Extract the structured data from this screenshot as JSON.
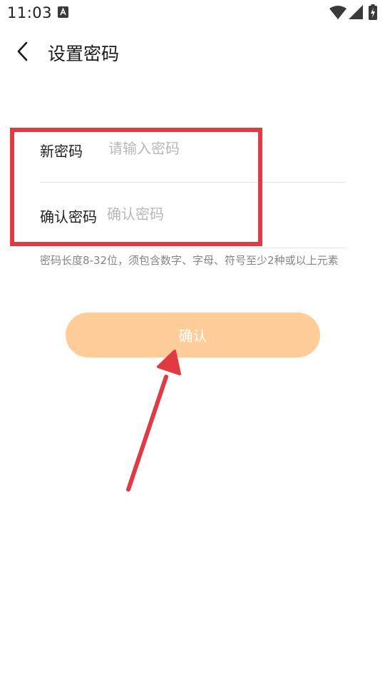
{
  "status_bar": {
    "time": "11:03",
    "icons": [
      "notification-a-icon",
      "wifi-icon",
      "signal-icon",
      "battery-charging-icon"
    ]
  },
  "header": {
    "back_icon": "chevron-left-icon",
    "title": "设置密码"
  },
  "form": {
    "new_password": {
      "label": "新密码",
      "placeholder": "请输入密码",
      "value": ""
    },
    "confirm_password": {
      "label": "确认密码",
      "placeholder": "确认密码",
      "value": ""
    },
    "hint": "密码长度8-32位，须包含数字、字母、符号至少2种或以上元素"
  },
  "confirm_button": {
    "label": "确认",
    "enabled": false
  },
  "annotation": {
    "color": "#e03a44"
  },
  "colors": {
    "button_bg": "#ffcd99",
    "button_text": "#ffffff",
    "placeholder": "#b8b8b8",
    "hint": "#858585",
    "divider": "#e3e3e3"
  }
}
